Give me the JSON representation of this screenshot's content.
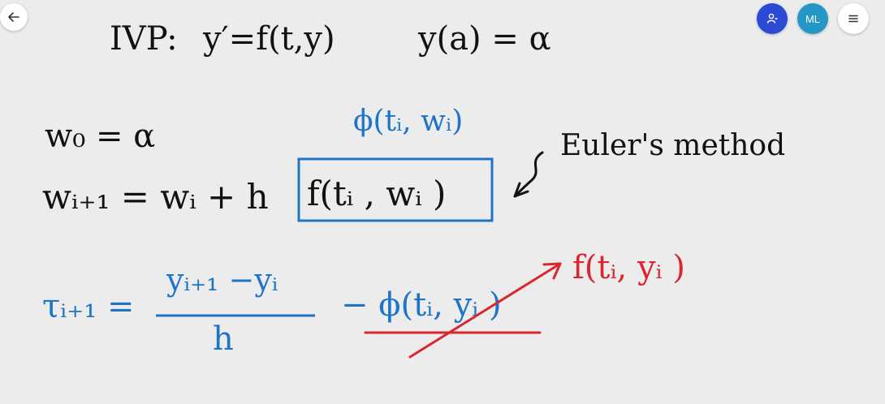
{
  "toolbar": {
    "back_icon": "arrow-left-icon",
    "user_icon": "person-icon",
    "avatar_initials": "ML",
    "menu_icon": "hamburger-menu-icon",
    "colors": {
      "user_button": "#2b4ad6",
      "avatar_bg": "#2597c6"
    }
  },
  "ink_colors": {
    "black": "#111111",
    "blue": "#1e74c6",
    "red": "#d9262f"
  },
  "notes": {
    "ivp_label": "IVP:",
    "ivp_ode": "y′=f(t,y)",
    "ivp_initial": "y(a) = α",
    "w0_eq": "w₀ = α",
    "phi_label": "ϕ(tᵢ, wᵢ)",
    "euler_lhs": "wᵢ₊₁ = wᵢ + h",
    "euler_f": "f(tᵢ , wᵢ )",
    "euler_method": "Euler's method",
    "tau_lhs": "τᵢ₊₁ =",
    "fraction_numerator": "yᵢ₊₁ −yᵢ",
    "fraction_denominator": "h",
    "phi_minus": "− ϕ(tᵢ, yᵢ )",
    "correction": "f(tᵢ, yᵢ )"
  }
}
